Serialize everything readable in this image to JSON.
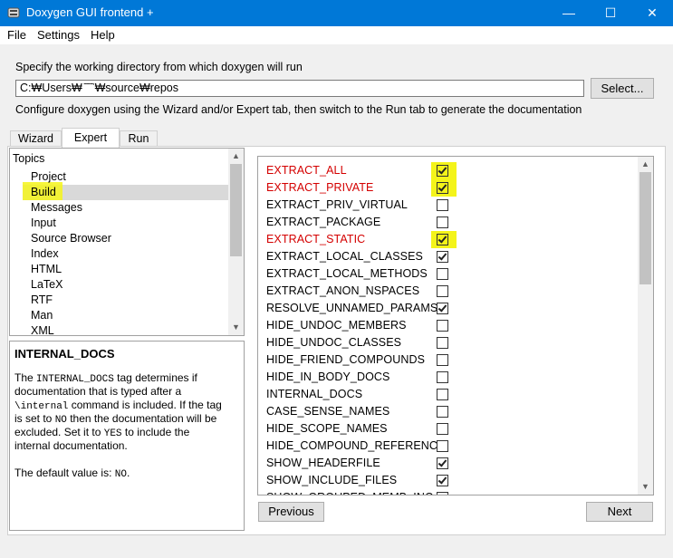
{
  "window": {
    "title": "Doxygen GUI frontend +",
    "controls": {
      "minimize": "—",
      "maximize": "☐",
      "close": "✕"
    }
  },
  "menu": [
    "File",
    "Settings",
    "Help"
  ],
  "working_dir": {
    "label": "Specify the working directory from which doxygen will run",
    "value": "C:₩Users₩   ̄ ̄ ̄ ̈₩source₩repos",
    "select_button": "Select..."
  },
  "configure_text": "Configure doxygen using the Wizard and/or Expert tab, then switch to the Run tab to generate the documentation",
  "tabs": [
    {
      "label": "Wizard",
      "active": false
    },
    {
      "label": "Expert",
      "active": true
    },
    {
      "label": "Run",
      "active": false
    }
  ],
  "topics": {
    "header": "Topics",
    "items": [
      "Project",
      "Build",
      "Messages",
      "Input",
      "Source Browser",
      "Index",
      "HTML",
      "LaTeX",
      "RTF",
      "Man",
      "XML"
    ],
    "selected": "Build"
  },
  "help": {
    "title": "INTERNAL_DOCS",
    "lines": [
      [
        {
          "t": "The "
        },
        {
          "t": "INTERNAL_DOCS",
          "mono": true
        },
        {
          "t": " tag determines if"
        }
      ],
      [
        {
          "t": "documentation that is typed after a"
        }
      ],
      [
        {
          "t": "\\internal",
          "mono": true
        },
        {
          "t": " command is included. If the tag"
        }
      ],
      [
        {
          "t": "is set to "
        },
        {
          "t": "NO",
          "mono": true
        },
        {
          "t": " then the documentation will be"
        }
      ],
      [
        {
          "t": "excluded. Set it to "
        },
        {
          "t": "YES",
          "mono": true
        },
        {
          "t": " to include the"
        }
      ],
      [
        {
          "t": "internal documentation."
        }
      ],
      [
        {
          "t": ""
        }
      ],
      [
        {
          "t": "The default value is: "
        },
        {
          "t": "NO",
          "mono": true
        },
        {
          "t": "."
        }
      ]
    ]
  },
  "options": [
    {
      "name": "EXTRACT_ALL",
      "checked": true,
      "changed": true,
      "highlight": true
    },
    {
      "name": "EXTRACT_PRIVATE",
      "checked": true,
      "changed": true,
      "highlight": true
    },
    {
      "name": "EXTRACT_PRIV_VIRTUAL",
      "checked": false,
      "changed": false,
      "highlight": false
    },
    {
      "name": "EXTRACT_PACKAGE",
      "checked": false,
      "changed": false,
      "highlight": false
    },
    {
      "name": "EXTRACT_STATIC",
      "checked": true,
      "changed": true,
      "highlight": true
    },
    {
      "name": "EXTRACT_LOCAL_CLASSES",
      "checked": true,
      "changed": false,
      "highlight": false
    },
    {
      "name": "EXTRACT_LOCAL_METHODS",
      "checked": false,
      "changed": false,
      "highlight": false
    },
    {
      "name": "EXTRACT_ANON_NSPACES",
      "checked": false,
      "changed": false,
      "highlight": false
    },
    {
      "name": "RESOLVE_UNNAMED_PARAMS",
      "checked": true,
      "changed": false,
      "highlight": false
    },
    {
      "name": "HIDE_UNDOC_MEMBERS",
      "checked": false,
      "changed": false,
      "highlight": false
    },
    {
      "name": "HIDE_UNDOC_CLASSES",
      "checked": false,
      "changed": false,
      "highlight": false
    },
    {
      "name": "HIDE_FRIEND_COMPOUNDS",
      "checked": false,
      "changed": false,
      "highlight": false
    },
    {
      "name": "HIDE_IN_BODY_DOCS",
      "checked": false,
      "changed": false,
      "highlight": false
    },
    {
      "name": "INTERNAL_DOCS",
      "checked": false,
      "changed": false,
      "highlight": false
    },
    {
      "name": "CASE_SENSE_NAMES",
      "checked": false,
      "changed": false,
      "highlight": false
    },
    {
      "name": "HIDE_SCOPE_NAMES",
      "checked": false,
      "changed": false,
      "highlight": false
    },
    {
      "name": "HIDE_COMPOUND_REFERENCE",
      "checked": false,
      "changed": false,
      "highlight": false
    },
    {
      "name": "SHOW_HEADERFILE",
      "checked": true,
      "changed": false,
      "highlight": false
    },
    {
      "name": "SHOW_INCLUDE_FILES",
      "checked": true,
      "changed": false,
      "highlight": false
    },
    {
      "name": "SHOW_GROUPED_MEMB_INC",
      "checked": false,
      "changed": false,
      "highlight": false
    }
  ],
  "nav": {
    "previous": "Previous",
    "next": "Next"
  },
  "colors": {
    "changed_option": "#d40000",
    "highlight": "#f4f41a",
    "titlebar": "#0078d7"
  },
  "scroll_arrows": {
    "up": "▲",
    "down": "▼"
  }
}
